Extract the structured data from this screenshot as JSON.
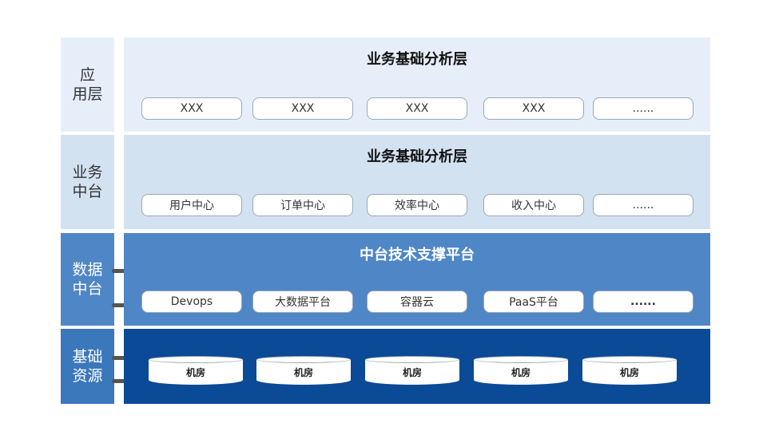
{
  "rows": [
    {
      "label": "应\n用层",
      "title": "业务基础分析层",
      "items": [
        "XXX",
        "XXX",
        "XXX",
        "XXX",
        "......"
      ]
    },
    {
      "label": "业务\n中台",
      "title": "业务基础分析层",
      "items": [
        "用户中心",
        "订单中心",
        "效率中心",
        "收入中心",
        "......"
      ]
    },
    {
      "label": "数据\n中台",
      "title": "中台技术支撑平台",
      "items": [
        "Devops",
        "大数据平台",
        "容器云",
        "PaaS平台",
        "......"
      ]
    },
    {
      "label": "基础\n资源",
      "items": [
        "机房",
        "机房",
        "机房",
        "机房",
        "机房"
      ]
    }
  ],
  "colors": {
    "row1": "#e6eff9",
    "row2": "#d3e2f1",
    "row3": "#4f86c6",
    "row4": "#0b4a96"
  }
}
